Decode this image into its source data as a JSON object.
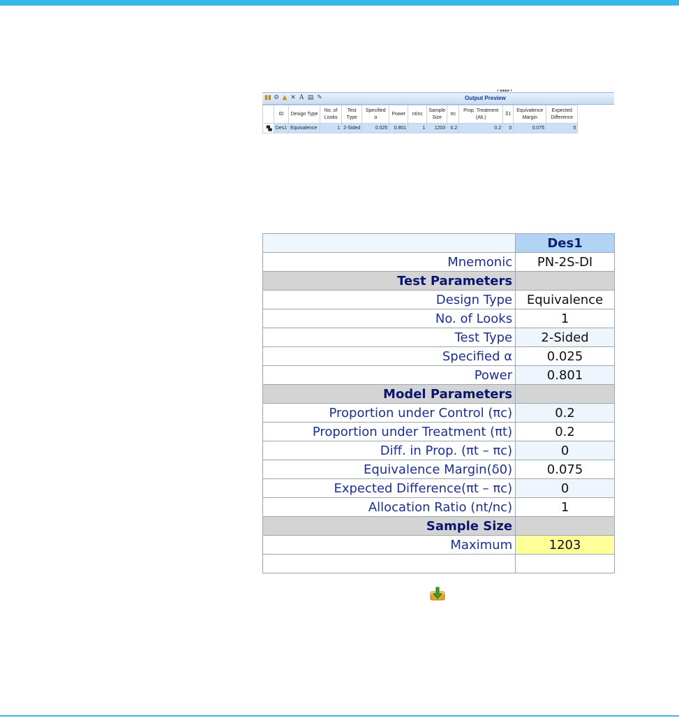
{
  "output_preview": {
    "title": "Output Preview",
    "toolbar_icons": [
      "columns-icon",
      "settings-icon",
      "save-icon",
      "delete-icon",
      "font-icon",
      "print-icon",
      "details-icon"
    ],
    "columns": [
      "ID",
      "Design Type",
      "No. of Looks",
      "Test Type",
      "Specified α",
      "Power",
      "nt/nc",
      "Sample Size",
      "πc",
      "Prop. Treatment (Alt.)",
      "δ1",
      "Equivalence Margin",
      "Expected Difference"
    ],
    "row": [
      "Des1",
      "Equivalence",
      "1",
      "2-Sided",
      "0.025",
      "0.801",
      "1",
      "1203",
      "0.2",
      "0.2",
      "0",
      "0.075",
      "0"
    ]
  },
  "summary": {
    "design": "Des1",
    "mnemonic_label": "Mnemonic",
    "mnemonic": "PN-2S-DI",
    "sections": {
      "test": "Test Parameters",
      "model": "Model Parameters",
      "sample": "Sample Size"
    },
    "rows": {
      "design_type": {
        "label": "Design Type",
        "value": "Equivalence"
      },
      "looks": {
        "label": "No. of Looks",
        "value": "1"
      },
      "test_type": {
        "label": "Test Type",
        "value": "2-Sided"
      },
      "alpha": {
        "label": "Specified α",
        "value": "0.025"
      },
      "power": {
        "label": "Power",
        "value": "0.801"
      },
      "prop_control": {
        "label": "Proportion under Control (πc)",
        "value": "0.2"
      },
      "prop_treatment": {
        "label": "Proportion under Treatment (πt)",
        "value": "0.2"
      },
      "diff_prop": {
        "label": "Diff. in Prop. (πt – πc)",
        "value": "0"
      },
      "margin": {
        "label": "Equivalence Margin(δ0)",
        "value": "0.075"
      },
      "expected_diff": {
        "label": "Expected Difference(πt – πc)",
        "value": "0"
      },
      "alloc": {
        "label": "Allocation Ratio (nt/nc)",
        "value": "1"
      },
      "maximum": {
        "label": "Maximum",
        "value": "1203"
      }
    }
  },
  "colors": {
    "accent": "#35b7e8",
    "header_blue": "#b3d3f5",
    "highlight_yellow": "#ffff99"
  }
}
